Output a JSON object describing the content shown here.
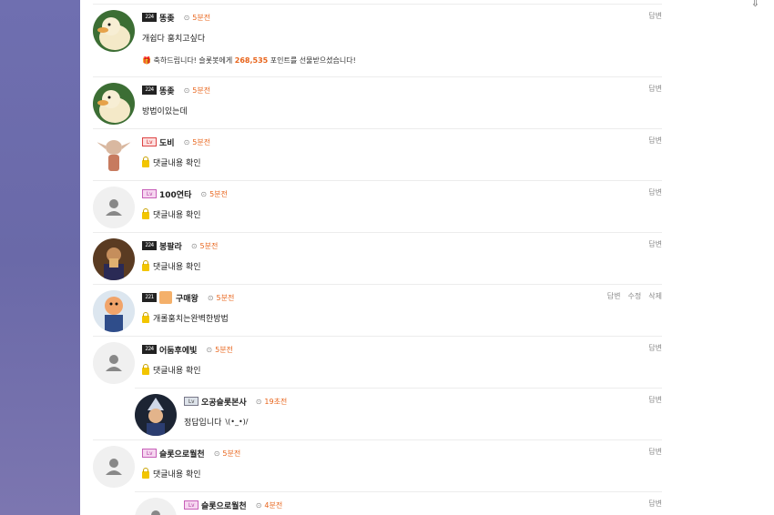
{
  "comments": [
    {
      "nick": "똥좆",
      "level": "224",
      "time": "5분전",
      "text": "개쉽다 훔치고싶다",
      "actions": [
        "답변"
      ],
      "gift": {
        "prefix": "축하드립니다! 슬롯봇에게 ",
        "points": "268,535",
        "suffix": " 포인트를 선물받으셨습니다!"
      }
    },
    {
      "nick": "똥좆",
      "level": "224",
      "time": "5분전",
      "text": "방법이있는데",
      "actions": [
        "답변"
      ]
    },
    {
      "nick": "도비",
      "level": "Lv",
      "time": "5분전",
      "text": "댓글내용 확인",
      "actions": [
        "답변"
      ]
    },
    {
      "nick": "100연타",
      "level": "Lv",
      "time": "5분전",
      "text": "댓글내용 확인",
      "actions": [
        "답변"
      ]
    },
    {
      "nick": "봉팔라",
      "level": "224",
      "time": "5분전",
      "text": "댓글내용 확인",
      "actions": [
        "답변"
      ]
    },
    {
      "nick": "구매왕",
      "level": "221",
      "time": "5분전",
      "text": "개롤훔치는완벽한방법",
      "actions": [
        "답변",
        "수정",
        "삭제"
      ]
    },
    {
      "nick": "어둠후에빛",
      "level": "224",
      "time": "5분전",
      "text": "댓글내용 확인",
      "actions": [
        "답변"
      ]
    },
    {
      "nick": "오공슬롯본사",
      "level": "Lv",
      "time": "19초전",
      "text": "정답입니다",
      "emoticon": "\\(•_•)/",
      "actions": [
        "답변"
      ]
    },
    {
      "nick": "슬롯으로월천",
      "level": "Lv",
      "time": "5분전",
      "text": "댓글내용 확인",
      "actions": [
        "답변"
      ]
    },
    {
      "nick": "슬롯으로월천",
      "level": "Lv",
      "time": "4분전",
      "text": "",
      "actions": [
        "답변"
      ]
    }
  ]
}
